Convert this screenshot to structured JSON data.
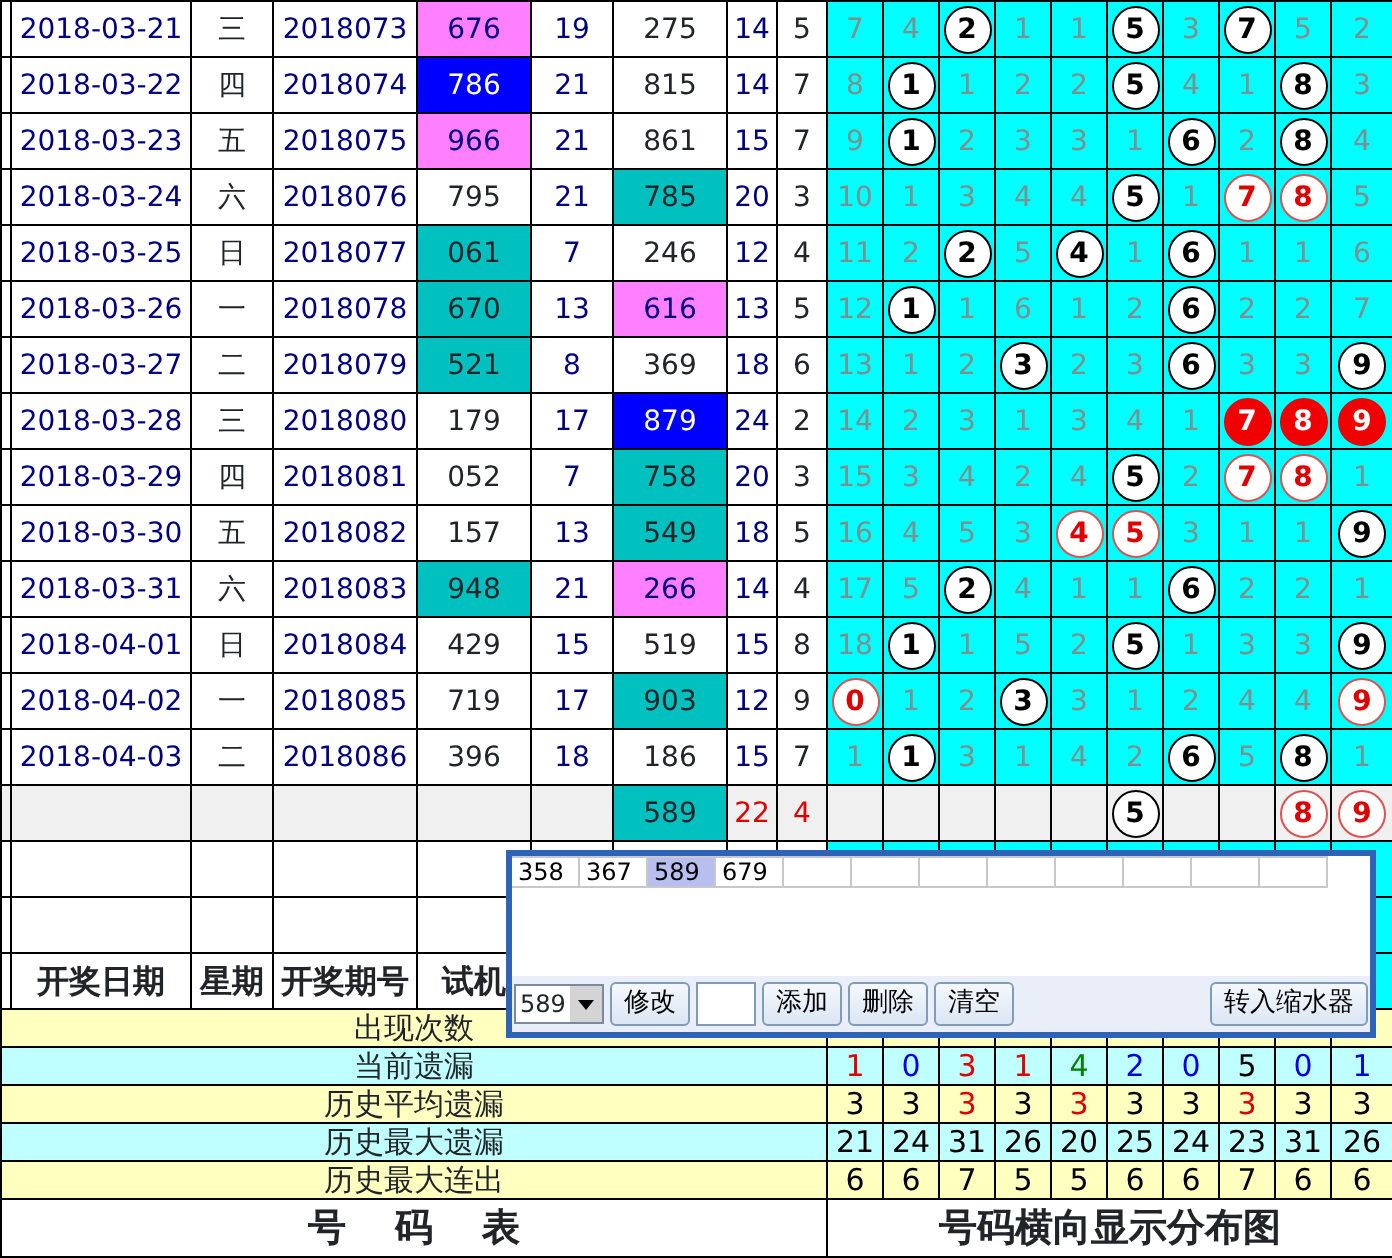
{
  "rows": [
    {
      "kind": "draw",
      "date": "2018-03-21",
      "weekday": "三",
      "period": "2018073",
      "test_number": {
        "text": "676",
        "color": "#ff80ff"
      },
      "column_5": "19",
      "column_6": {
        "text": "275"
      },
      "column_7": "14",
      "column_8": "5",
      "grid": [
        {
          "kind": "count",
          "text": "7"
        },
        {
          "kind": "count",
          "text": "4"
        },
        {
          "kind": "ball",
          "text": "2"
        },
        {
          "kind": "count",
          "text": "1"
        },
        {
          "kind": "count",
          "text": "1"
        },
        {
          "kind": "ball",
          "text": "5"
        },
        {
          "kind": "count",
          "text": "3"
        },
        {
          "kind": "ball",
          "text": "7"
        },
        {
          "kind": "count",
          "text": "5"
        },
        {
          "kind": "count",
          "text": "2"
        }
      ]
    },
    {
      "kind": "draw",
      "date": "2018-03-22",
      "weekday": "四",
      "period": "2018074",
      "test_number": {
        "text": "786",
        "color": "#0000ff"
      },
      "column_5": "21",
      "column_6": {
        "text": "815"
      },
      "column_7": "14",
      "column_8": "7",
      "grid": [
        {
          "kind": "count",
          "text": "8"
        },
        {
          "kind": "ball",
          "text": "1"
        },
        {
          "kind": "count",
          "text": "1"
        },
        {
          "kind": "count",
          "text": "2"
        },
        {
          "kind": "count",
          "text": "2"
        },
        {
          "kind": "ball",
          "text": "5"
        },
        {
          "kind": "count",
          "text": "4"
        },
        {
          "kind": "count",
          "text": "1"
        },
        {
          "kind": "ball",
          "text": "8"
        },
        {
          "kind": "count",
          "text": "3"
        }
      ]
    },
    {
      "kind": "draw",
      "date": "2018-03-23",
      "weekday": "五",
      "period": "2018075",
      "test_number": {
        "text": "966",
        "color": "#ff80ff"
      },
      "column_5": "21",
      "column_6": {
        "text": "861"
      },
      "column_7": "15",
      "column_8": "7",
      "grid": [
        {
          "kind": "count",
          "text": "9"
        },
        {
          "kind": "ball",
          "text": "1"
        },
        {
          "kind": "count",
          "text": "2"
        },
        {
          "kind": "count",
          "text": "3"
        },
        {
          "kind": "count",
          "text": "3"
        },
        {
          "kind": "count",
          "text": "1"
        },
        {
          "kind": "ball",
          "text": "6"
        },
        {
          "kind": "count",
          "text": "2"
        },
        {
          "kind": "ball",
          "text": "8"
        },
        {
          "kind": "count",
          "text": "4"
        }
      ]
    },
    {
      "kind": "draw",
      "date": "2018-03-24",
      "weekday": "六",
      "period": "2018076",
      "test_number": {
        "text": "795"
      },
      "column_5": "21",
      "column_6": {
        "text": "785",
        "color": "#00c0c0"
      },
      "column_7": "20",
      "column_8": "3",
      "grid": [
        {
          "kind": "count",
          "text": "10"
        },
        {
          "kind": "count",
          "text": "1"
        },
        {
          "kind": "count",
          "text": "3"
        },
        {
          "kind": "count",
          "text": "4"
        },
        {
          "kind": "count",
          "text": "4"
        },
        {
          "kind": "ball",
          "text": "5"
        },
        {
          "kind": "count",
          "text": "1"
        },
        {
          "kind": "red_ring",
          "text": "7"
        },
        {
          "kind": "red_ring",
          "text": "8"
        },
        {
          "kind": "count",
          "text": "5"
        }
      ]
    },
    {
      "kind": "draw",
      "date": "2018-03-25",
      "weekday": "日",
      "period": "2018077",
      "test_number": {
        "text": "061",
        "color": "#00c0c0"
      },
      "column_5": "7",
      "column_6": {
        "text": "246"
      },
      "column_7": "12",
      "column_8": "4",
      "grid": [
        {
          "kind": "count",
          "text": "11"
        },
        {
          "kind": "count",
          "text": "2"
        },
        {
          "kind": "ball",
          "text": "2"
        },
        {
          "kind": "count",
          "text": "5"
        },
        {
          "kind": "ball",
          "text": "4"
        },
        {
          "kind": "count",
          "text": "1"
        },
        {
          "kind": "ball",
          "text": "6"
        },
        {
          "kind": "count",
          "text": "1"
        },
        {
          "kind": "count",
          "text": "1"
        },
        {
          "kind": "count",
          "text": "6"
        }
      ]
    },
    {
      "kind": "draw",
      "date": "2018-03-26",
      "weekday": "一",
      "period": "2018078",
      "test_number": {
        "text": "670",
        "color": "#00c0c0"
      },
      "column_5": "13",
      "column_6": {
        "text": "616",
        "color": "#ff80ff"
      },
      "column_7": "13",
      "column_8": "5",
      "grid": [
        {
          "kind": "count",
          "text": "12"
        },
        {
          "kind": "ball",
          "text": "1"
        },
        {
          "kind": "count",
          "text": "1"
        },
        {
          "kind": "count",
          "text": "6"
        },
        {
          "kind": "count",
          "text": "1"
        },
        {
          "kind": "count",
          "text": "2"
        },
        {
          "kind": "ball",
          "text": "6"
        },
        {
          "kind": "count",
          "text": "2"
        },
        {
          "kind": "count",
          "text": "2"
        },
        {
          "kind": "count",
          "text": "7"
        }
      ]
    },
    {
      "kind": "draw",
      "date": "2018-03-27",
      "weekday": "二",
      "period": "2018079",
      "test_number": {
        "text": "521",
        "color": "#00c0c0"
      },
      "column_5": "8",
      "column_6": {
        "text": "369"
      },
      "column_7": "18",
      "column_8": "6",
      "grid": [
        {
          "kind": "count",
          "text": "13"
        },
        {
          "kind": "count",
          "text": "1"
        },
        {
          "kind": "count",
          "text": "2"
        },
        {
          "kind": "ball",
          "text": "3"
        },
        {
          "kind": "count",
          "text": "2"
        },
        {
          "kind": "count",
          "text": "3"
        },
        {
          "kind": "ball",
          "text": "6"
        },
        {
          "kind": "count",
          "text": "3"
        },
        {
          "kind": "count",
          "text": "3"
        },
        {
          "kind": "ball",
          "text": "9"
        }
      ]
    },
    {
      "kind": "draw",
      "date": "2018-03-28",
      "weekday": "三",
      "period": "2018080",
      "test_number": {
        "text": "179"
      },
      "column_5": "17",
      "column_6": {
        "text": "879",
        "color": "#0000ff"
      },
      "column_7": "24",
      "column_8": "2",
      "grid": [
        {
          "kind": "count",
          "text": "14"
        },
        {
          "kind": "count",
          "text": "2"
        },
        {
          "kind": "count",
          "text": "3"
        },
        {
          "kind": "count",
          "text": "1"
        },
        {
          "kind": "count",
          "text": "3"
        },
        {
          "kind": "count",
          "text": "4"
        },
        {
          "kind": "count",
          "text": "1"
        },
        {
          "kind": "red_ball",
          "text": "7"
        },
        {
          "kind": "red_ball",
          "text": "8"
        },
        {
          "kind": "red_ball",
          "text": "9"
        }
      ]
    },
    {
      "kind": "draw",
      "date": "2018-03-29",
      "weekday": "四",
      "period": "2018081",
      "test_number": {
        "text": "052"
      },
      "column_5": "7",
      "column_6": {
        "text": "758",
        "color": "#00c0c0"
      },
      "column_7": "20",
      "column_8": "3",
      "grid": [
        {
          "kind": "count",
          "text": "15"
        },
        {
          "kind": "count",
          "text": "3"
        },
        {
          "kind": "count",
          "text": "4"
        },
        {
          "kind": "count",
          "text": "2"
        },
        {
          "kind": "count",
          "text": "4"
        },
        {
          "kind": "ball",
          "text": "5"
        },
        {
          "kind": "count",
          "text": "2"
        },
        {
          "kind": "red_ring",
          "text": "7"
        },
        {
          "kind": "red_ring",
          "text": "8"
        },
        {
          "kind": "count",
          "text": "1"
        }
      ]
    },
    {
      "kind": "draw",
      "date": "2018-03-30",
      "weekday": "五",
      "period": "2018082",
      "test_number": {
        "text": "157"
      },
      "column_5": "13",
      "column_6": {
        "text": "549",
        "color": "#00c0c0"
      },
      "column_7": "18",
      "column_8": "5",
      "grid": [
        {
          "kind": "count",
          "text": "16"
        },
        {
          "kind": "count",
          "text": "4"
        },
        {
          "kind": "count",
          "text": "5"
        },
        {
          "kind": "count",
          "text": "3"
        },
        {
          "kind": "red_ring",
          "text": "4"
        },
        {
          "kind": "red_ring",
          "text": "5"
        },
        {
          "kind": "count",
          "text": "3"
        },
        {
          "kind": "count",
          "text": "1"
        },
        {
          "kind": "count",
          "text": "1"
        },
        {
          "kind": "ball",
          "text": "9"
        }
      ]
    },
    {
      "kind": "draw",
      "date": "2018-03-31",
      "weekday": "六",
      "period": "2018083",
      "test_number": {
        "text": "948",
        "color": "#00c0c0"
      },
      "column_5": "21",
      "column_6": {
        "text": "266",
        "color": "#ff80ff"
      },
      "column_7": "14",
      "column_8": "4",
      "grid": [
        {
          "kind": "count",
          "text": "17"
        },
        {
          "kind": "count",
          "text": "5"
        },
        {
          "kind": "ball",
          "text": "2"
        },
        {
          "kind": "count",
          "text": "4"
        },
        {
          "kind": "count",
          "text": "1"
        },
        {
          "kind": "count",
          "text": "1"
        },
        {
          "kind": "ball",
          "text": "6"
        },
        {
          "kind": "count",
          "text": "2"
        },
        {
          "kind": "count",
          "text": "2"
        },
        {
          "kind": "count",
          "text": "1"
        }
      ]
    },
    {
      "kind": "draw",
      "date": "2018-04-01",
      "weekday": "日",
      "period": "2018084",
      "test_number": {
        "text": "429"
      },
      "column_5": "15",
      "column_6": {
        "text": "519"
      },
      "column_7": "15",
      "column_8": "8",
      "grid": [
        {
          "kind": "count",
          "text": "18"
        },
        {
          "kind": "ball",
          "text": "1"
        },
        {
          "kind": "count",
          "text": "1"
        },
        {
          "kind": "count",
          "text": "5"
        },
        {
          "kind": "count",
          "text": "2"
        },
        {
          "kind": "ball",
          "text": "5"
        },
        {
          "kind": "count",
          "text": "1"
        },
        {
          "kind": "count",
          "text": "3"
        },
        {
          "kind": "count",
          "text": "3"
        },
        {
          "kind": "ball",
          "text": "9"
        }
      ]
    },
    {
      "kind": "draw",
      "date": "2018-04-02",
      "weekday": "一",
      "period": "2018085",
      "test_number": {
        "text": "719"
      },
      "column_5": "17",
      "column_6": {
        "text": "903",
        "color": "#00c0c0"
      },
      "column_7": "12",
      "column_8": "9",
      "grid": [
        {
          "kind": "red_ring",
          "text": "0"
        },
        {
          "kind": "count",
          "text": "1"
        },
        {
          "kind": "count",
          "text": "2"
        },
        {
          "kind": "ball",
          "text": "3"
        },
        {
          "kind": "count",
          "text": "3"
        },
        {
          "kind": "count",
          "text": "1"
        },
        {
          "kind": "count",
          "text": "2"
        },
        {
          "kind": "count",
          "text": "4"
        },
        {
          "kind": "count",
          "text": "4"
        },
        {
          "kind": "red_ring",
          "text": "9"
        }
      ]
    },
    {
      "kind": "draw",
      "date": "2018-04-03",
      "weekday": "二",
      "period": "2018086",
      "test_number": {
        "text": "396"
      },
      "column_5": "18",
      "column_6": {
        "text": "186"
      },
      "column_7": "15",
      "column_8": "7",
      "grid": [
        {
          "kind": "count",
          "text": "1"
        },
        {
          "kind": "ball",
          "text": "1"
        },
        {
          "kind": "count",
          "text": "3"
        },
        {
          "kind": "count",
          "text": "1"
        },
        {
          "kind": "count",
          "text": "4"
        },
        {
          "kind": "count",
          "text": "2"
        },
        {
          "kind": "ball",
          "text": "6"
        },
        {
          "kind": "count",
          "text": "5"
        },
        {
          "kind": "ball",
          "text": "8"
        },
        {
          "kind": "count",
          "text": "1"
        }
      ]
    },
    {
      "kind": "forecast",
      "column_6": {
        "text": "589",
        "color": "#00c0c0"
      },
      "column_7": "22",
      "column_8": "4",
      "grid": [
        {
          "kind": "blank"
        },
        {
          "kind": "blank"
        },
        {
          "kind": "blank"
        },
        {
          "kind": "blank"
        },
        {
          "kind": "blank"
        },
        {
          "kind": "ball",
          "text": "5"
        },
        {
          "kind": "blank"
        },
        {
          "kind": "blank"
        },
        {
          "kind": "red_ring",
          "text": "8"
        },
        {
          "kind": "red_ring",
          "text": "9"
        }
      ]
    }
  ],
  "headers": [
    "开奖日期",
    "星期",
    "开奖期号",
    "试机"
  ],
  "stats": [
    {
      "label": "出现次数"
    },
    {
      "label": "当前遗漏",
      "values": [
        {
          "text": "1",
          "color": "#e00000"
        },
        {
          "text": "0",
          "color": "#0000e0"
        },
        {
          "text": "3",
          "color": "#e00000"
        },
        {
          "text": "1",
          "color": "#e00000"
        },
        {
          "text": "4",
          "color": "#008000"
        },
        {
          "text": "2",
          "color": "#0000e0"
        },
        {
          "text": "0",
          "color": "#0000e0"
        },
        {
          "text": "5",
          "color": "#000000"
        },
        {
          "text": "0",
          "color": "#0000e0"
        },
        {
          "text": "1",
          "color": "#0000e0"
        }
      ]
    },
    {
      "label": "历史平均遗漏",
      "values": [
        {
          "text": "3",
          "color": "#000000"
        },
        {
          "text": "3",
          "color": "#000000"
        },
        {
          "text": "3",
          "color": "#e00000"
        },
        {
          "text": "3",
          "color": "#000000"
        },
        {
          "text": "3",
          "color": "#e00000"
        },
        {
          "text": "3",
          "color": "#000000"
        },
        {
          "text": "3",
          "color": "#000000"
        },
        {
          "text": "3",
          "color": "#e00000"
        },
        {
          "text": "3",
          "color": "#000000"
        },
        {
          "text": "3",
          "color": "#000000"
        }
      ]
    },
    {
      "label": "历史最大遗漏",
      "values": [
        {
          "text": "21",
          "color": "#000000"
        },
        {
          "text": "24",
          "color": "#000000"
        },
        {
          "text": "31",
          "color": "#000000"
        },
        {
          "text": "26",
          "color": "#000000"
        },
        {
          "text": "20",
          "color": "#000000"
        },
        {
          "text": "25",
          "color": "#000000"
        },
        {
          "text": "24",
          "color": "#000000"
        },
        {
          "text": "23",
          "color": "#000000"
        },
        {
          "text": "31",
          "color": "#000000"
        },
        {
          "text": "26",
          "color": "#000000"
        }
      ]
    },
    {
      "label": "历史最大连出",
      "values": [
        {
          "text": "6",
          "color": "#000000"
        },
        {
          "text": "6",
          "color": "#000000"
        },
        {
          "text": "7",
          "color": "#000000"
        },
        {
          "text": "5",
          "color": "#000000"
        },
        {
          "text": "5",
          "color": "#000000"
        },
        {
          "text": "6",
          "color": "#000000"
        },
        {
          "text": "6",
          "color": "#000000"
        },
        {
          "text": "7",
          "color": "#000000"
        },
        {
          "text": "6",
          "color": "#000000"
        },
        {
          "text": "6",
          "color": "#000000"
        }
      ]
    }
  ],
  "footer": {
    "table_title": "号 码 表",
    "chart_title": "号码横向显示分布图"
  },
  "popup": {
    "numbers": [
      {
        "text": "358",
        "selected": false
      },
      {
        "text": "367",
        "selected": false
      },
      {
        "text": "589",
        "selected": true
      },
      {
        "text": "679",
        "selected": false
      }
    ],
    "controls": [
      {
        "kind": "select",
        "value": "589"
      },
      {
        "kind": "button",
        "label": "修改"
      },
      {
        "kind": "input"
      },
      {
        "kind": "button",
        "label": "添加"
      },
      {
        "kind": "button",
        "label": "删除"
      },
      {
        "kind": "button",
        "label": "清空"
      }
    ],
    "action_button": "转入缩水器"
  }
}
